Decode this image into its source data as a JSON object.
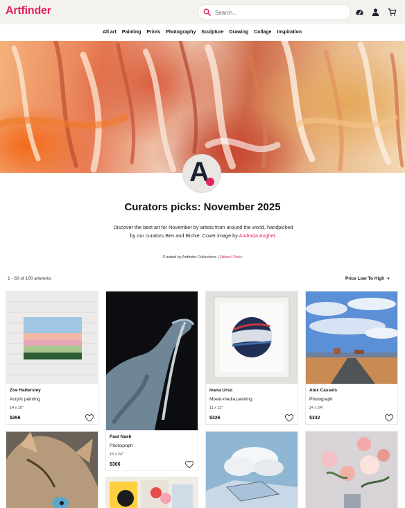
{
  "header": {
    "logo": "Artfinder",
    "search_placeholder": "Search...",
    "icons": [
      "search-icon",
      "dashboard-icon",
      "account-icon",
      "cart-icon"
    ]
  },
  "nav": {
    "items": [
      "All art",
      "Painting",
      "Prints",
      "Photography",
      "Sculpture",
      "Drawing",
      "Collage",
      "Inspiration"
    ]
  },
  "collection": {
    "avatar_letter": "A",
    "title": "Curators picks: November 2025",
    "description_main": "Discover the best art for November by artists from around the world, handpicked by our curators Ben and Richie. Cover image by ",
    "description_link": "Andrada Anghel",
    "description_end": ".",
    "credit_prefix": "Created by Artfinder Collections | ",
    "credit_link": "Editors' Picks"
  },
  "results": {
    "count": "1 - 60 of 100 artworks",
    "sort": "Price Low To High"
  },
  "cards": [
    {
      "artist": "Zoe Hattersley",
      "medium": "Acrylic painting",
      "size": "14 x 10\"",
      "price": "$266"
    },
    {
      "artist": "Paul Nash",
      "medium": "Photograph",
      "size": "16 x 24\"",
      "price": "$306"
    },
    {
      "artist": "Ivana Urso",
      "medium": "Mixed-media painting",
      "size": "11 x 11\"",
      "price": "$326"
    },
    {
      "artist": "Alex Cassels",
      "medium": "Photograph",
      "size": "24 x 24\"",
      "price": "$332"
    }
  ],
  "colors": {
    "brand": "#e0245e",
    "topbar_bg": "#f4f2ef"
  }
}
